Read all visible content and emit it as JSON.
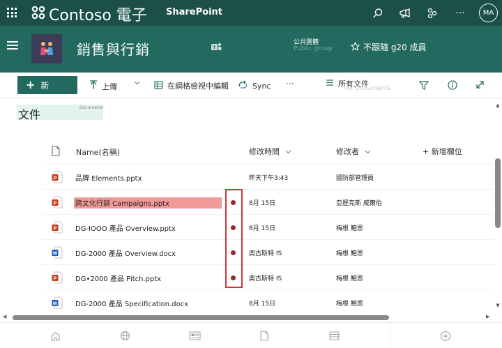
{
  "suite_bar": {
    "brand": "Contoso 電子",
    "app_title": "SharePoint",
    "avatar_initials": "MA"
  },
  "site": {
    "name": "銷售與行銷",
    "group_type": "公共團體",
    "group_type_ghost": "Public group",
    "follow_label": "不跟隨 g20 成員"
  },
  "command_bar": {
    "new_label": "新",
    "upload_label": "上傳",
    "grid_edit_label": "在網格檢視中編輯",
    "sync_label": "Sync",
    "more_label": "···",
    "view_label": "所有文件",
    "view_ghost": "All Documents"
  },
  "library": {
    "title": "文件",
    "title_ghost": "Documents"
  },
  "table": {
    "headers": {
      "name": "Name(名稱)",
      "modified": "修改時間",
      "modified_by": "修改者",
      "add_column": "+ 新增欄位"
    },
    "rows": [
      {
        "type": "pptx",
        "name": "品牌 Elements.pptx",
        "modified": "昨天下午3:43",
        "modified_by": "國防部管理員"
      },
      {
        "type": "pptx",
        "name": "跨文化行銷 Campaigns.pptx",
        "modified": "8月 15日",
        "modified_by": "亞歷克斯 威爾伯"
      },
      {
        "type": "pptx",
        "name": "DG-IOOO 產品 Overview.pptx",
        "modified": "8月 15日",
        "modified_by": "梅根 鮑恩"
      },
      {
        "type": "docx",
        "name": "DG-2000 產品 Overview.docx",
        "modified": "奧古斯特 IS",
        "modified_by": "梅根 鮑恩"
      },
      {
        "type": "pptx",
        "name": "DG•2000 產品 Pitch.pptx",
        "modified": "奧古斯特 IS",
        "modified_by": "梅根 鮑恩"
      },
      {
        "type": "docx",
        "name": "DG-2000 產品 Specification.docx",
        "modified": "8月 15日",
        "modified_by": "梅根 鮑恩"
      }
    ]
  },
  "colors": {
    "suite_bar": "#1b4f48",
    "site_header": "#226a5f",
    "accent": "#226a5f",
    "highlight_red": "#d13438"
  },
  "icons": {
    "search": "search-icon",
    "megaphone": "megaphone-icon",
    "share": "share-network-icon",
    "settings": "more-icon"
  }
}
